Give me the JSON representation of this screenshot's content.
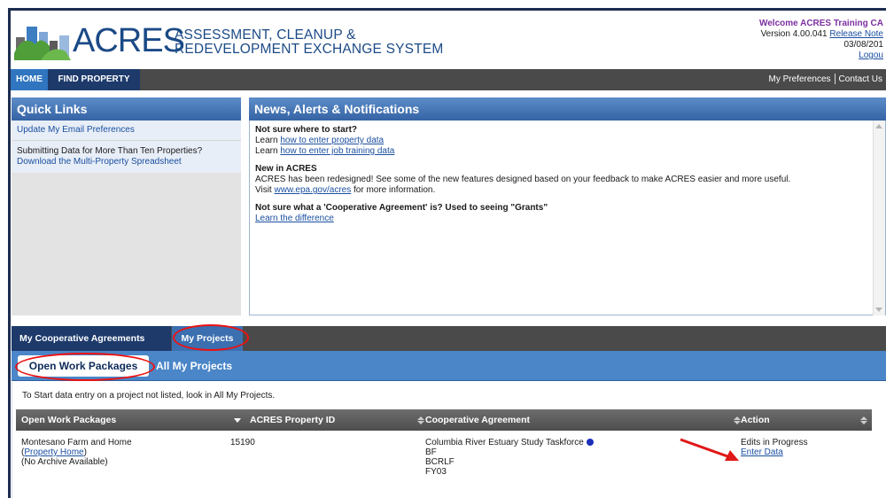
{
  "header": {
    "brand": "ACRES",
    "brand_sub_line1": "ASSESSMENT, CLEANUP &",
    "brand_sub_line2": "REDEVELOPMENT EXCHANGE SYSTEM",
    "welcome": "Welcome ACRES Training CA",
    "version": "Version 4.00.041",
    "release_notes": "Release Note",
    "date": "03/08/201",
    "logout": "Logou"
  },
  "nav": {
    "home": "HOME",
    "find_property": "FIND PROPERTY",
    "my_preferences": "My Preferences",
    "contact_us": "Contact Us"
  },
  "quick_links": {
    "title": "Quick Links",
    "item1": "Update My Email Preferences",
    "item2_text": "Submitting Data for More Than Ten Properties?",
    "item2_link": "Download the Multi-Property Spreadsheet"
  },
  "news": {
    "title": "News, Alerts & Notifications",
    "s1_heading": "Not sure where to start?",
    "learn": "Learn",
    "link_property": "how to enter property data",
    "link_job": "how to enter job training data",
    "s2_heading": "New in ACRES",
    "s2_text": "ACRES has been redesigned! See some of the new features designed based on your feedback to make ACRES easier and more useful.",
    "visit": "Visit",
    "visit_link": "www.epa.gov/acres",
    "visit_tail": "for more information.",
    "s3_heading": "Not sure what a 'Cooperative Agreement' is? Used to seeing \"Grants\"",
    "s3_link": "Learn the difference"
  },
  "tabs": {
    "coop": "My Cooperative Agreements",
    "projects": "My Projects",
    "open_wp": "Open Work Packages",
    "all_projects": "All My Projects"
  },
  "content": {
    "hint": "To Start data entry on a project not listed, look in All My Projects.",
    "columns": [
      "Open Work Packages",
      "ACRES Property ID",
      "Cooperative Agreement",
      "Action"
    ],
    "row": {
      "name": "Montesano Farm and Home",
      "property_home": "Property Home",
      "no_archive": "(No Archive Available)",
      "property_id": "15190",
      "agreement": "Columbia River Estuary Study Taskforce",
      "agreement_l2": "BF",
      "agreement_l3": "BCRLF",
      "agreement_l4": "FY03",
      "status": "Edits in Progress",
      "enter_data": "Enter Data"
    }
  }
}
